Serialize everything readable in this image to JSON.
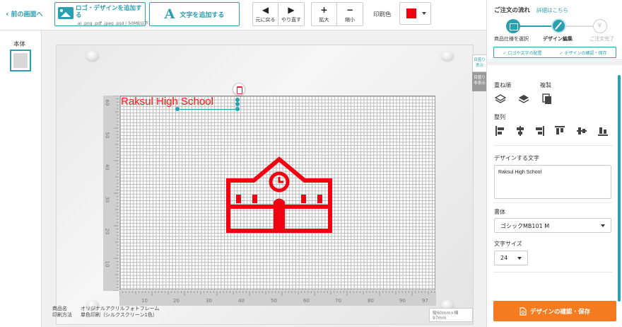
{
  "toolbar": {
    "back_label": "前の画面へ",
    "add_logo_label": "ロゴ・デザインを追加する",
    "add_logo_formats": ".ai .png .pdf .jpeg .psd / 50MB以下",
    "add_text_label": "文字を追加する",
    "undo_label": "元に戻る",
    "redo_label": "やり直す",
    "zoom_in_label": "拡大",
    "zoom_out_label": "縮小",
    "print_color_label": "印刷色",
    "print_color_value": "#f00010"
  },
  "left_panel": {
    "body_label": "本体"
  },
  "canvas": {
    "show_grid_label": "目盛り表示",
    "hide_grid_label": "目盛り非表示",
    "design_text": "Raksul High School",
    "size_tag": "縦60mm×横97mm",
    "ruler_v_ticks": [
      "60",
      "50",
      "40",
      "30",
      "20",
      "10"
    ],
    "ruler_h_ticks": [
      "10",
      "20",
      "30",
      "40",
      "50",
      "60",
      "70",
      "80",
      "90",
      "97"
    ],
    "icon": "school-icon",
    "accent_color": "#f00010"
  },
  "footer": {
    "product_name_key": "商品名",
    "product_name_value": "オリジナルアクリルフォトフレーム",
    "print_method_key": "印刷方法",
    "print_method_value": "単色印刷（シルクスクリーン1色）"
  },
  "order_flow": {
    "title": "ご注文の流れ",
    "details_link": "詳細はこちら",
    "steps": [
      "商品仕様を選択",
      "デザイン編集",
      "ご注文完了"
    ],
    "substeps": [
      "✓ ロゴや文字の配置",
      "✓ デザインの確認・保存"
    ]
  },
  "properties": {
    "layer_order_label": "重ね順",
    "duplicate_label": "複製",
    "align_label": "整列",
    "design_text_label": "デザインする文字",
    "design_text_value": "Raksul High School",
    "font_label": "書体",
    "font_value": "ゴシックMB101 M",
    "size_label": "文字サイズ",
    "size_value": "24"
  },
  "confirm_button_label": "デザインの確認・保存",
  "colors": {
    "accent": "#2a9fb0",
    "confirm": "#f47b20",
    "design": "#f00010"
  }
}
